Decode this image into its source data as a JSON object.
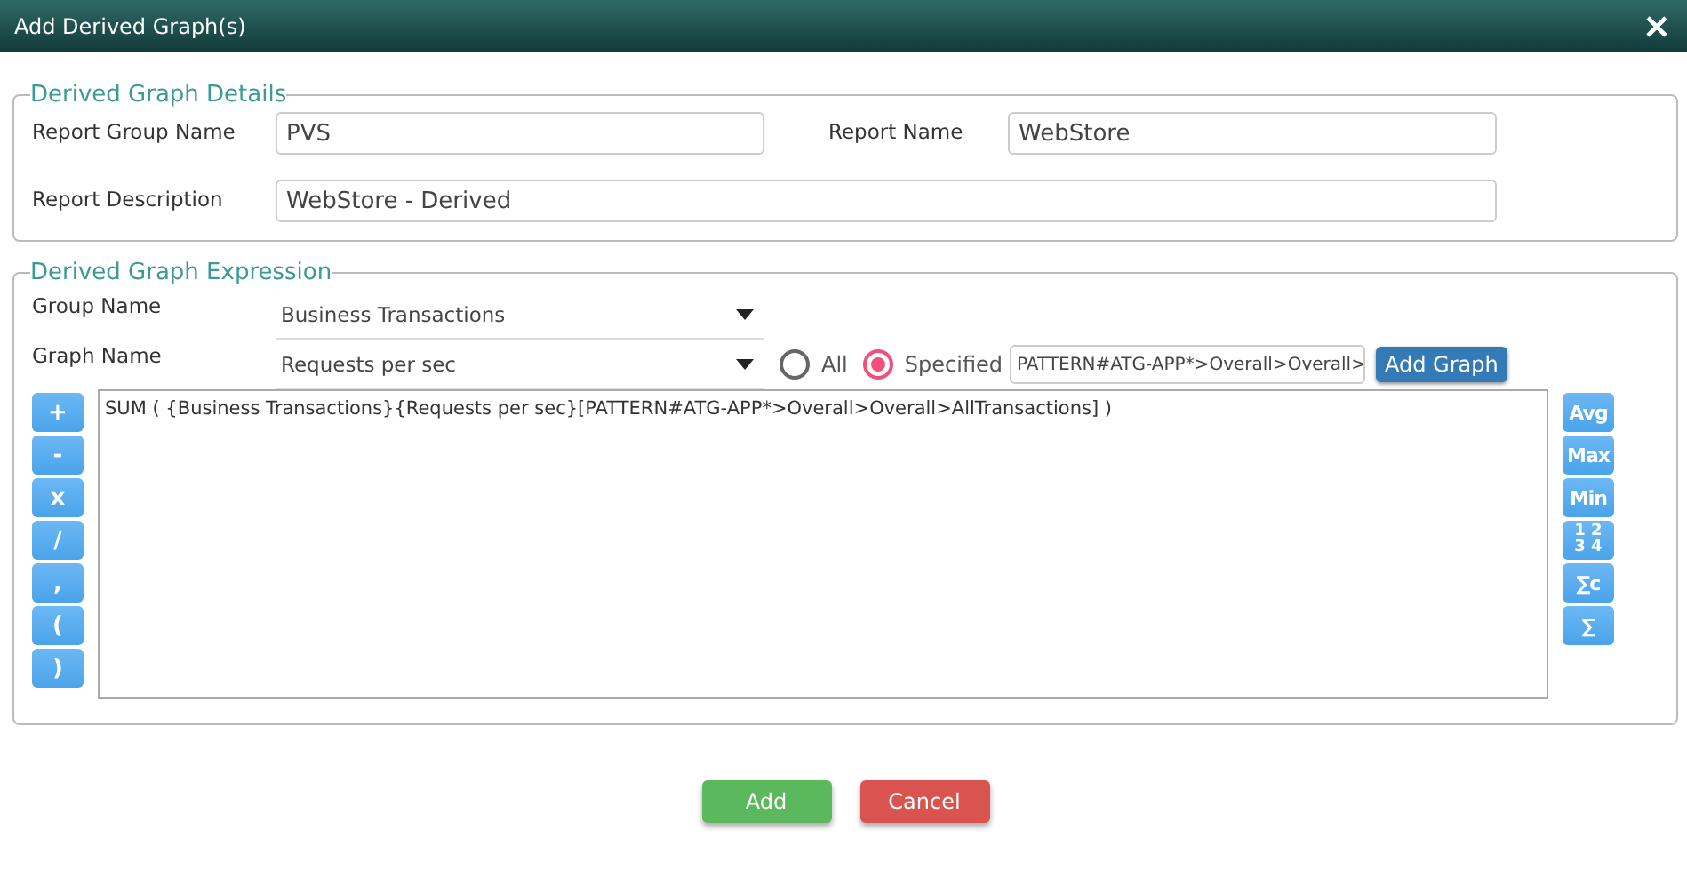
{
  "window": {
    "title": "Add Derived Graph(s)"
  },
  "details": {
    "legend": "Derived Graph Details",
    "report_group_name": {
      "label": "Report Group Name",
      "value": "PVS"
    },
    "report_name": {
      "label": "Report Name",
      "value": "WebStore"
    },
    "report_description": {
      "label": "Report Description",
      "value": "WebStore - Derived"
    }
  },
  "expression": {
    "legend": "Derived Graph Expression",
    "group_name": {
      "label": "Group Name",
      "value": "Business Transactions"
    },
    "graph_name": {
      "label": "Graph Name",
      "value": "Requests per sec"
    },
    "scope": [
      {
        "label": "All",
        "selected": false
      },
      {
        "label": "Specified",
        "selected": true
      }
    ],
    "specified_value": "PATTERN#ATG-APP*>Overall>Overall>",
    "add_graph_button": "Add Graph",
    "text": "SUM ( {Business Transactions}{Requests per sec}[PATTERN#ATG-APP*>Overall>Overall>AllTransactions] )",
    "operators": [
      "+",
      "-",
      "x",
      "/",
      ",",
      "(",
      ")"
    ],
    "functions": [
      "Avg",
      "Max",
      "Min",
      "1 2 3 4",
      "∑c",
      "∑"
    ]
  },
  "buttons": [
    {
      "label": "Add",
      "kind": "primary"
    },
    {
      "label": "Cancel",
      "kind": "danger"
    }
  ]
}
